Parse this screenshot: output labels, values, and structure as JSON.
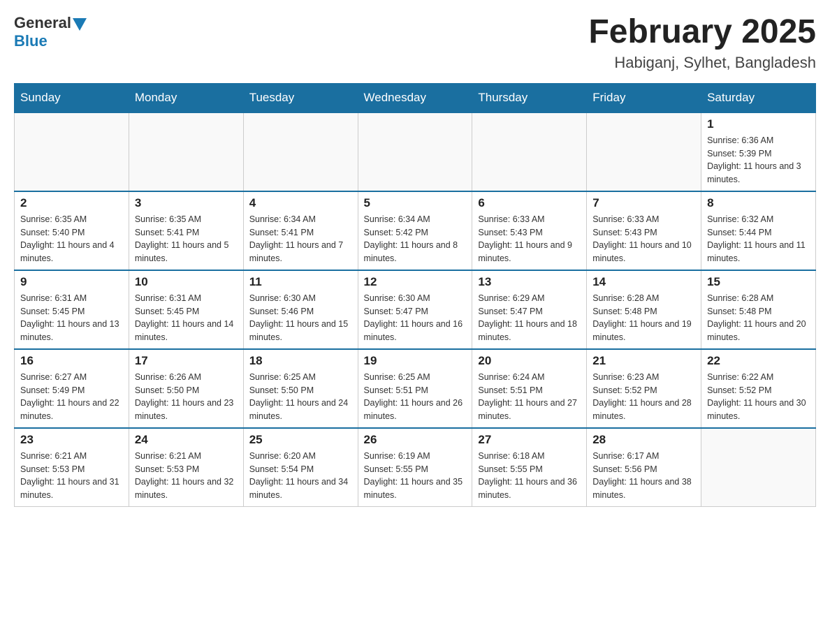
{
  "header": {
    "logo_general": "General",
    "logo_blue": "Blue",
    "month_year": "February 2025",
    "location": "Habiganj, Sylhet, Bangladesh"
  },
  "weekdays": [
    "Sunday",
    "Monday",
    "Tuesday",
    "Wednesday",
    "Thursday",
    "Friday",
    "Saturday"
  ],
  "weeks": [
    [
      {
        "day": "",
        "info": ""
      },
      {
        "day": "",
        "info": ""
      },
      {
        "day": "",
        "info": ""
      },
      {
        "day": "",
        "info": ""
      },
      {
        "day": "",
        "info": ""
      },
      {
        "day": "",
        "info": ""
      },
      {
        "day": "1",
        "info": "Sunrise: 6:36 AM\nSunset: 5:39 PM\nDaylight: 11 hours and 3 minutes."
      }
    ],
    [
      {
        "day": "2",
        "info": "Sunrise: 6:35 AM\nSunset: 5:40 PM\nDaylight: 11 hours and 4 minutes."
      },
      {
        "day": "3",
        "info": "Sunrise: 6:35 AM\nSunset: 5:41 PM\nDaylight: 11 hours and 5 minutes."
      },
      {
        "day": "4",
        "info": "Sunrise: 6:34 AM\nSunset: 5:41 PM\nDaylight: 11 hours and 7 minutes."
      },
      {
        "day": "5",
        "info": "Sunrise: 6:34 AM\nSunset: 5:42 PM\nDaylight: 11 hours and 8 minutes."
      },
      {
        "day": "6",
        "info": "Sunrise: 6:33 AM\nSunset: 5:43 PM\nDaylight: 11 hours and 9 minutes."
      },
      {
        "day": "7",
        "info": "Sunrise: 6:33 AM\nSunset: 5:43 PM\nDaylight: 11 hours and 10 minutes."
      },
      {
        "day": "8",
        "info": "Sunrise: 6:32 AM\nSunset: 5:44 PM\nDaylight: 11 hours and 11 minutes."
      }
    ],
    [
      {
        "day": "9",
        "info": "Sunrise: 6:31 AM\nSunset: 5:45 PM\nDaylight: 11 hours and 13 minutes."
      },
      {
        "day": "10",
        "info": "Sunrise: 6:31 AM\nSunset: 5:45 PM\nDaylight: 11 hours and 14 minutes."
      },
      {
        "day": "11",
        "info": "Sunrise: 6:30 AM\nSunset: 5:46 PM\nDaylight: 11 hours and 15 minutes."
      },
      {
        "day": "12",
        "info": "Sunrise: 6:30 AM\nSunset: 5:47 PM\nDaylight: 11 hours and 16 minutes."
      },
      {
        "day": "13",
        "info": "Sunrise: 6:29 AM\nSunset: 5:47 PM\nDaylight: 11 hours and 18 minutes."
      },
      {
        "day": "14",
        "info": "Sunrise: 6:28 AM\nSunset: 5:48 PM\nDaylight: 11 hours and 19 minutes."
      },
      {
        "day": "15",
        "info": "Sunrise: 6:28 AM\nSunset: 5:48 PM\nDaylight: 11 hours and 20 minutes."
      }
    ],
    [
      {
        "day": "16",
        "info": "Sunrise: 6:27 AM\nSunset: 5:49 PM\nDaylight: 11 hours and 22 minutes."
      },
      {
        "day": "17",
        "info": "Sunrise: 6:26 AM\nSunset: 5:50 PM\nDaylight: 11 hours and 23 minutes."
      },
      {
        "day": "18",
        "info": "Sunrise: 6:25 AM\nSunset: 5:50 PM\nDaylight: 11 hours and 24 minutes."
      },
      {
        "day": "19",
        "info": "Sunrise: 6:25 AM\nSunset: 5:51 PM\nDaylight: 11 hours and 26 minutes."
      },
      {
        "day": "20",
        "info": "Sunrise: 6:24 AM\nSunset: 5:51 PM\nDaylight: 11 hours and 27 minutes."
      },
      {
        "day": "21",
        "info": "Sunrise: 6:23 AM\nSunset: 5:52 PM\nDaylight: 11 hours and 28 minutes."
      },
      {
        "day": "22",
        "info": "Sunrise: 6:22 AM\nSunset: 5:52 PM\nDaylight: 11 hours and 30 minutes."
      }
    ],
    [
      {
        "day": "23",
        "info": "Sunrise: 6:21 AM\nSunset: 5:53 PM\nDaylight: 11 hours and 31 minutes."
      },
      {
        "day": "24",
        "info": "Sunrise: 6:21 AM\nSunset: 5:53 PM\nDaylight: 11 hours and 32 minutes."
      },
      {
        "day": "25",
        "info": "Sunrise: 6:20 AM\nSunset: 5:54 PM\nDaylight: 11 hours and 34 minutes."
      },
      {
        "day": "26",
        "info": "Sunrise: 6:19 AM\nSunset: 5:55 PM\nDaylight: 11 hours and 35 minutes."
      },
      {
        "day": "27",
        "info": "Sunrise: 6:18 AM\nSunset: 5:55 PM\nDaylight: 11 hours and 36 minutes."
      },
      {
        "day": "28",
        "info": "Sunrise: 6:17 AM\nSunset: 5:56 PM\nDaylight: 11 hours and 38 minutes."
      },
      {
        "day": "",
        "info": ""
      }
    ]
  ]
}
